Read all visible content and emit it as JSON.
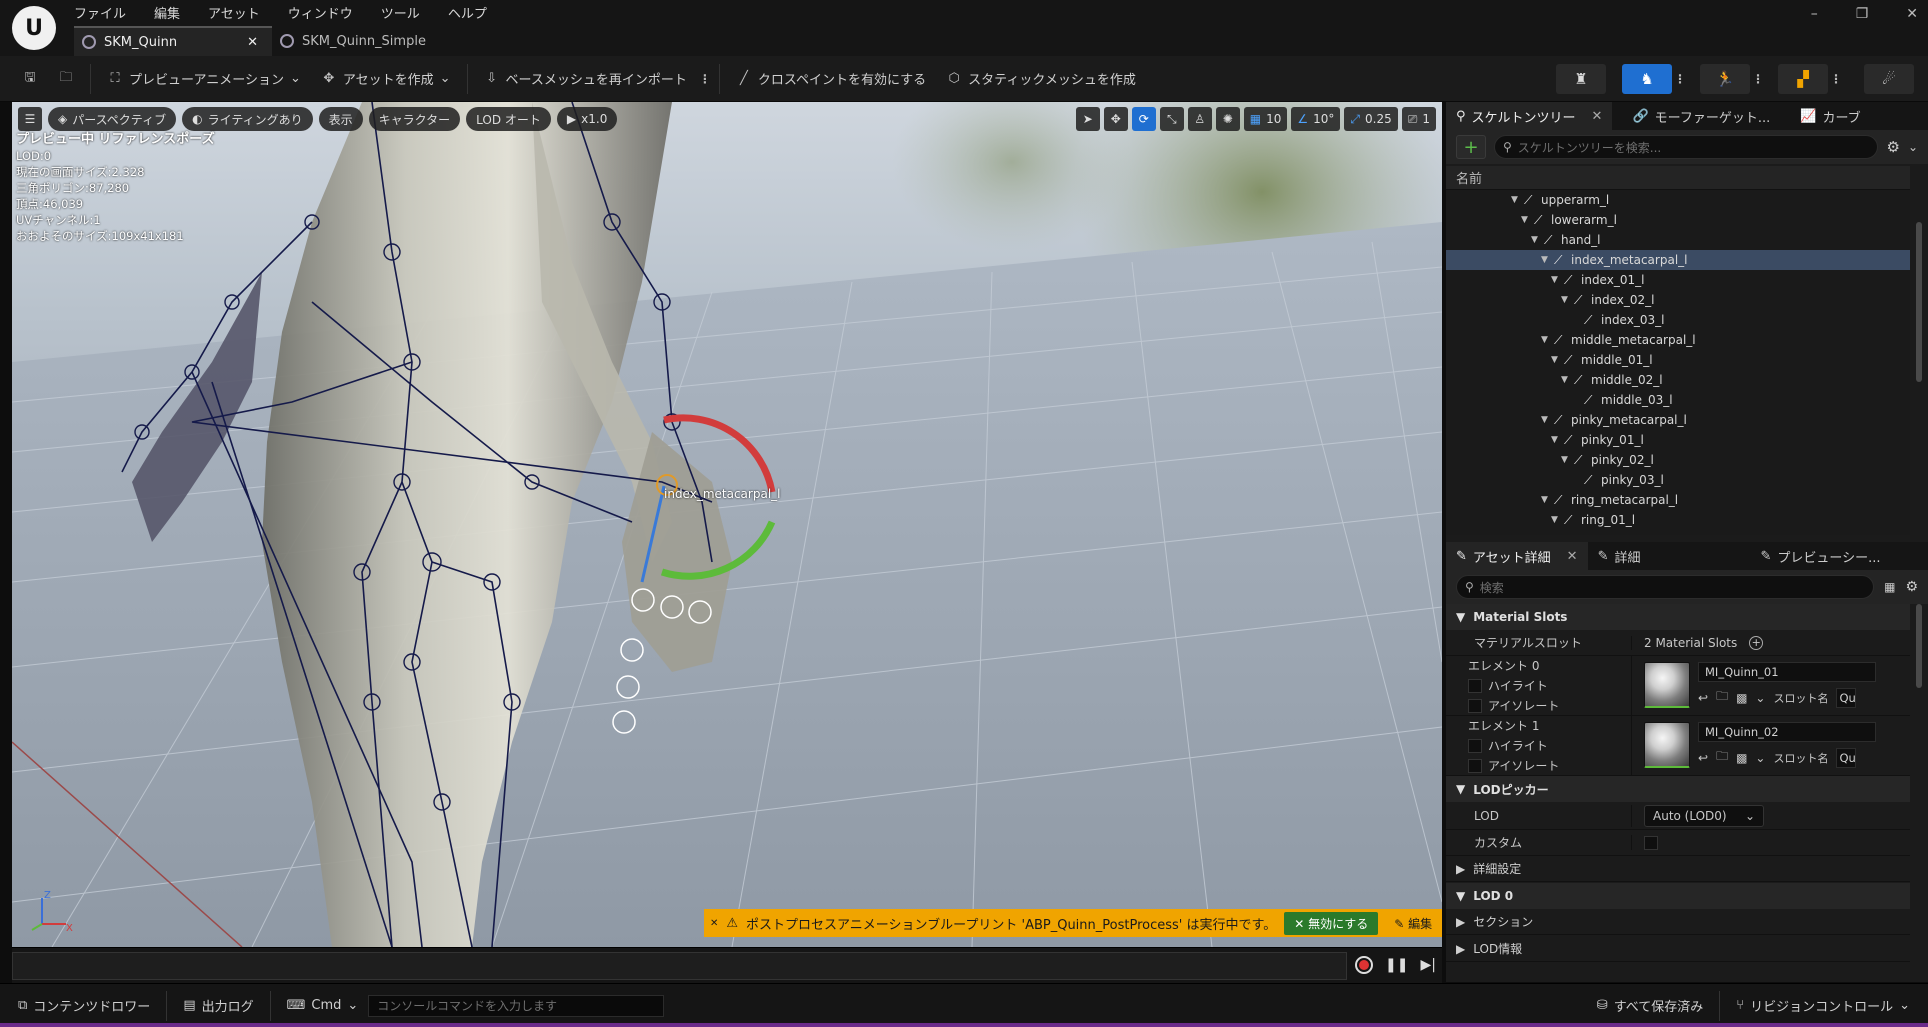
{
  "menu": [
    "ファイル",
    "編集",
    "アセット",
    "ウィンドウ",
    "ツール",
    "ヘルプ"
  ],
  "tabs": [
    {
      "label": "SKM_Quinn",
      "active": true
    },
    {
      "label": "SKM_Quinn_Simple",
      "active": false
    }
  ],
  "window_controls": {
    "minimize": "–",
    "restore": "❐",
    "close": "✕"
  },
  "toolbar": {
    "preview_animation": "プレビューアニメーション",
    "create_asset": "アセットを作成",
    "reimport_base_mesh": "ベースメッシュを再インポート",
    "enable_cloth_paint": "クロスペイントを有効にする",
    "create_static_mesh": "スタティックメッシュを作成"
  },
  "viewport": {
    "buttons": {
      "perspective": "パースペクティブ",
      "lighting": "ライティングあり",
      "show": "表示",
      "character": "キャラクター",
      "lod": "LOD オート",
      "speed": "x1.0"
    },
    "right_buttons": {
      "grid_size": "10",
      "angle": "10°",
      "scale": "0.25",
      "camera": "1"
    },
    "stats": {
      "title": "プレビュー中 リファレンスポーズ",
      "lod": "LOD:0",
      "screen_size": "現在の画面サイズ:2.328",
      "triangles": "三角ポリゴン:87,280",
      "vertices": "頂点:46,039",
      "uv_channels": "UVチャンネル:1",
      "approx_size": "おおよそのサイズ:109x41x181"
    },
    "selected_bone_label": "index_metacarpal_l",
    "warning": {
      "text": "ポストプロセスアニメーションブループリント 'ABP_Quinn_PostProcess' は実行中です。",
      "disable": "無効にする",
      "edit": "編集"
    },
    "axis": {
      "z": "Z",
      "x": "X"
    }
  },
  "skeleton_panel": {
    "tabs": [
      {
        "label": "スケルトンツリー"
      },
      {
        "label": "モーファーゲット..."
      },
      {
        "label": "カーブ"
      }
    ],
    "search_placeholder": "スケルトンツリーを検索...",
    "column_header": "名前",
    "rows": [
      {
        "label": "upperarm_l",
        "depth": 9,
        "expanded": true,
        "selected": false
      },
      {
        "label": "lowerarm_l",
        "depth": 10,
        "expanded": true,
        "selected": false
      },
      {
        "label": "hand_l",
        "depth": 11,
        "expanded": true,
        "selected": false
      },
      {
        "label": "index_metacarpal_l",
        "depth": 12,
        "expanded": true,
        "selected": true
      },
      {
        "label": "index_01_l",
        "depth": 13,
        "expanded": true,
        "selected": false
      },
      {
        "label": "index_02_l",
        "depth": 14,
        "expanded": true,
        "selected": false
      },
      {
        "label": "index_03_l",
        "depth": 15,
        "expanded": false,
        "selected": false
      },
      {
        "label": "middle_metacarpal_l",
        "depth": 12,
        "expanded": true,
        "selected": false
      },
      {
        "label": "middle_01_l",
        "depth": 13,
        "expanded": true,
        "selected": false
      },
      {
        "label": "middle_02_l",
        "depth": 14,
        "expanded": true,
        "selected": false
      },
      {
        "label": "middle_03_l",
        "depth": 15,
        "expanded": false,
        "selected": false
      },
      {
        "label": "pinky_metacarpal_l",
        "depth": 12,
        "expanded": true,
        "selected": false
      },
      {
        "label": "pinky_01_l",
        "depth": 13,
        "expanded": true,
        "selected": false
      },
      {
        "label": "pinky_02_l",
        "depth": 14,
        "expanded": true,
        "selected": false
      },
      {
        "label": "pinky_03_l",
        "depth": 15,
        "expanded": false,
        "selected": false
      },
      {
        "label": "ring_metacarpal_l",
        "depth": 12,
        "expanded": true,
        "selected": false
      },
      {
        "label": "ring_01_l",
        "depth": 13,
        "expanded": true,
        "selected": false
      }
    ]
  },
  "details_panel": {
    "tabs": [
      {
        "label": "アセット詳細"
      },
      {
        "label": "詳細"
      },
      {
        "label": "プレビューシー..."
      }
    ],
    "search_placeholder": "検索",
    "material_slots": {
      "section": "Material Slots",
      "slots_label": "マテリアルスロット",
      "slots_value": "2 Material Slots",
      "elements": [
        {
          "label": "エレメント 0",
          "highlight": "ハイライト",
          "isolate": "アイソレート",
          "material": "MI_Quinn_01",
          "slot_name_label": "スロット名",
          "slot_name": "Qu"
        },
        {
          "label": "エレメント 1",
          "highlight": "ハイライト",
          "isolate": "アイソレート",
          "material": "MI_Quinn_02",
          "slot_name_label": "スロット名",
          "slot_name": "Qu"
        }
      ]
    },
    "lod_picker": {
      "section": "LODピッカー",
      "lod_label": "LOD",
      "lod_value": "Auto (LOD0)",
      "custom_label": "カスタム"
    },
    "advanced": "詳細設定",
    "lod0": {
      "section": "LOD 0",
      "sections": "セクション",
      "lod_info": "LOD情報"
    }
  },
  "statusbar": {
    "content_drawer": "コンテンツドロワー",
    "output_log": "出力ログ",
    "cmd": "Cmd",
    "console_placeholder": "コンソールコマンドを入力します",
    "save_all": "すべて保存済み",
    "revision_control": "リビジョンコントロール"
  },
  "colors": {
    "accent": "#1f6fd1",
    "warning": "#f0a400",
    "selection": "#3b4b63",
    "add": "#5cbc4b"
  }
}
